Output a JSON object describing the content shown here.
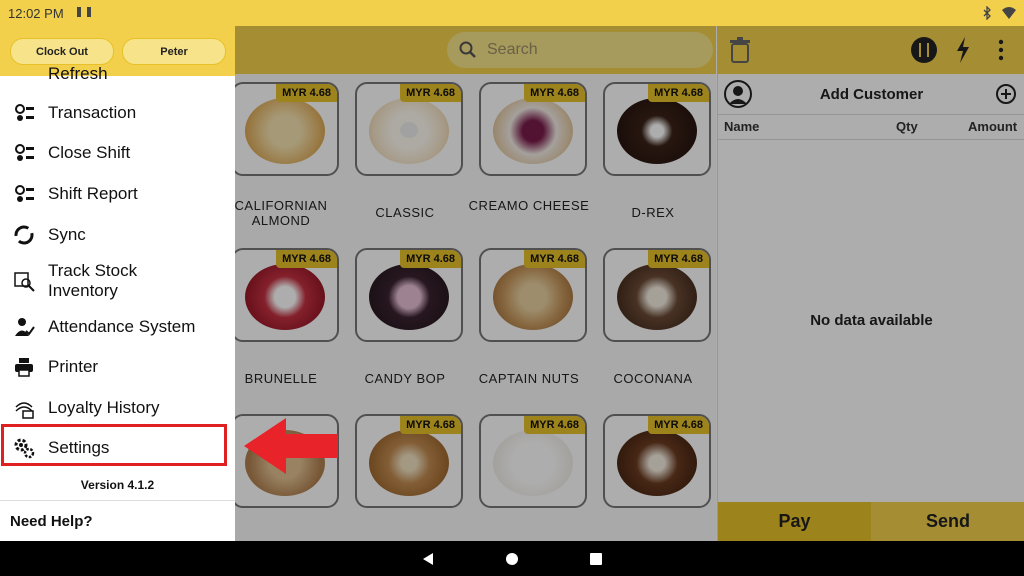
{
  "status_bar": {
    "time": "12:02 PM"
  },
  "search": {
    "placeholder": "Search"
  },
  "drawer": {
    "clock_out": "Clock Out",
    "user": "Peter",
    "items": [
      {
        "label": "Refresh",
        "icon": "refresh-icon"
      },
      {
        "label": "Transaction",
        "icon": "transaction-icon"
      },
      {
        "label": "Close Shift",
        "icon": "close-shift-icon"
      },
      {
        "label": "Shift Report",
        "icon": "shift-report-icon"
      },
      {
        "label": "Sync",
        "icon": "sync-icon"
      },
      {
        "label": "Track Stock Inventory",
        "icon": "track-stock-icon"
      },
      {
        "label": "Attendance System",
        "icon": "attendance-icon"
      },
      {
        "label": "Printer",
        "icon": "printer-icon"
      },
      {
        "label": "Loyalty History",
        "icon": "loyalty-icon"
      },
      {
        "label": "Settings",
        "icon": "gear-icon"
      }
    ],
    "version": "Version 4.1.2",
    "help": "Need Help?"
  },
  "products": [
    {
      "name": "CALIFORNIAN ALMOND",
      "price": "MYR 4.68"
    },
    {
      "name": "CLASSIC",
      "price": "MYR 4.68"
    },
    {
      "name": "CREAMO CHEESE",
      "price": "MYR 4.68"
    },
    {
      "name": "D-REX",
      "price": "MYR 4.68"
    },
    {
      "name": "BRUNELLE",
      "price": "MYR 4.68"
    },
    {
      "name": "CANDY BOP",
      "price": "MYR 4.68"
    },
    {
      "name": "CAPTAIN NUTS",
      "price": "MYR 4.68"
    },
    {
      "name": "COCONANA",
      "price": "MYR 4.68"
    },
    {
      "name": "",
      "price": ""
    },
    {
      "name": "",
      "price": "MYR 4.68"
    },
    {
      "name": "",
      "price": "MYR 4.68"
    },
    {
      "name": "",
      "price": "MYR 4.68"
    }
  ],
  "cart": {
    "add_customer": "Add Customer",
    "col_name": "Name",
    "col_qty": "Qty",
    "col_amount": "Amount",
    "empty": "No data available",
    "pay": "Pay",
    "send": "Send"
  },
  "colors": {
    "accent": "#f2d04c",
    "highlight": "#e02020"
  }
}
